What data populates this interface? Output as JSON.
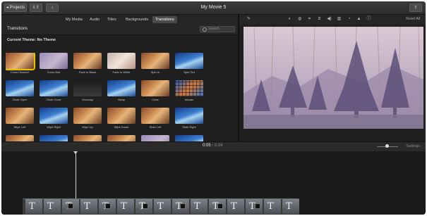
{
  "window": {
    "title": "My Movie 5"
  },
  "toolbar": {
    "projects_label": "◂ Projects",
    "import_icon": "import-icon",
    "share_icon": "share-icon"
  },
  "tabs": [
    "My Media",
    "Audio",
    "Titles",
    "Backgrounds",
    "Transitions"
  ],
  "active_tab": "Transitions",
  "browser": {
    "title": "Transitions",
    "search_placeholder": "Search",
    "theme_label": "Current Theme: No Theme"
  },
  "transitions": [
    {
      "label": "Cross Dissolve",
      "style": "warm",
      "selected": true
    },
    {
      "label": "Cross Blur",
      "style": "lav"
    },
    {
      "label": "Fade to Black",
      "style": "warm"
    },
    {
      "label": "Fade to White",
      "style": "pale"
    },
    {
      "label": "Spin In",
      "style": "warm"
    },
    {
      "label": "Spin Out",
      "style": "blue"
    },
    {
      "label": "Circle Open",
      "style": "blue"
    },
    {
      "label": "Circle Close",
      "style": "blue"
    },
    {
      "label": "Doorway",
      "style": "dark"
    },
    {
      "label": "Swap",
      "style": "blue"
    },
    {
      "label": "Cube",
      "style": "warm"
    },
    {
      "label": "Mosaic",
      "style": "mosaic"
    },
    {
      "label": "Wipe Left",
      "style": "warm"
    },
    {
      "label": "Wipe Right",
      "style": "blue"
    },
    {
      "label": "Wipe Up",
      "style": "warm"
    },
    {
      "label": "Wipe Down",
      "style": "warm"
    },
    {
      "label": "Slide Left",
      "style": "warm"
    },
    {
      "label": "Slide Right",
      "style": "blue"
    },
    {
      "label": "",
      "style": "warm"
    },
    {
      "label": "",
      "style": "blue"
    },
    {
      "label": "",
      "style": "warm"
    },
    {
      "label": "",
      "style": "warm"
    },
    {
      "label": "",
      "style": "lav"
    },
    {
      "label": "",
      "style": "blue"
    }
  ],
  "viewer_toolbar": {
    "icons": [
      "magic-wand-icon",
      "color-balance-icon",
      "color-correction-icon",
      "crop-icon",
      "stabilization-icon",
      "volume-icon",
      "noise-reduction-icon",
      "speed-icon",
      "filter-icon",
      "info-icon"
    ],
    "reset_label": "Reset All"
  },
  "timeline": {
    "current_time": "0:05",
    "separator": " / ",
    "total_time": "0:34",
    "settings_label": "Settings",
    "zoom_level": 0.45
  },
  "colors": {
    "selection": "#e5c300",
    "background": "#1f1f1f"
  }
}
